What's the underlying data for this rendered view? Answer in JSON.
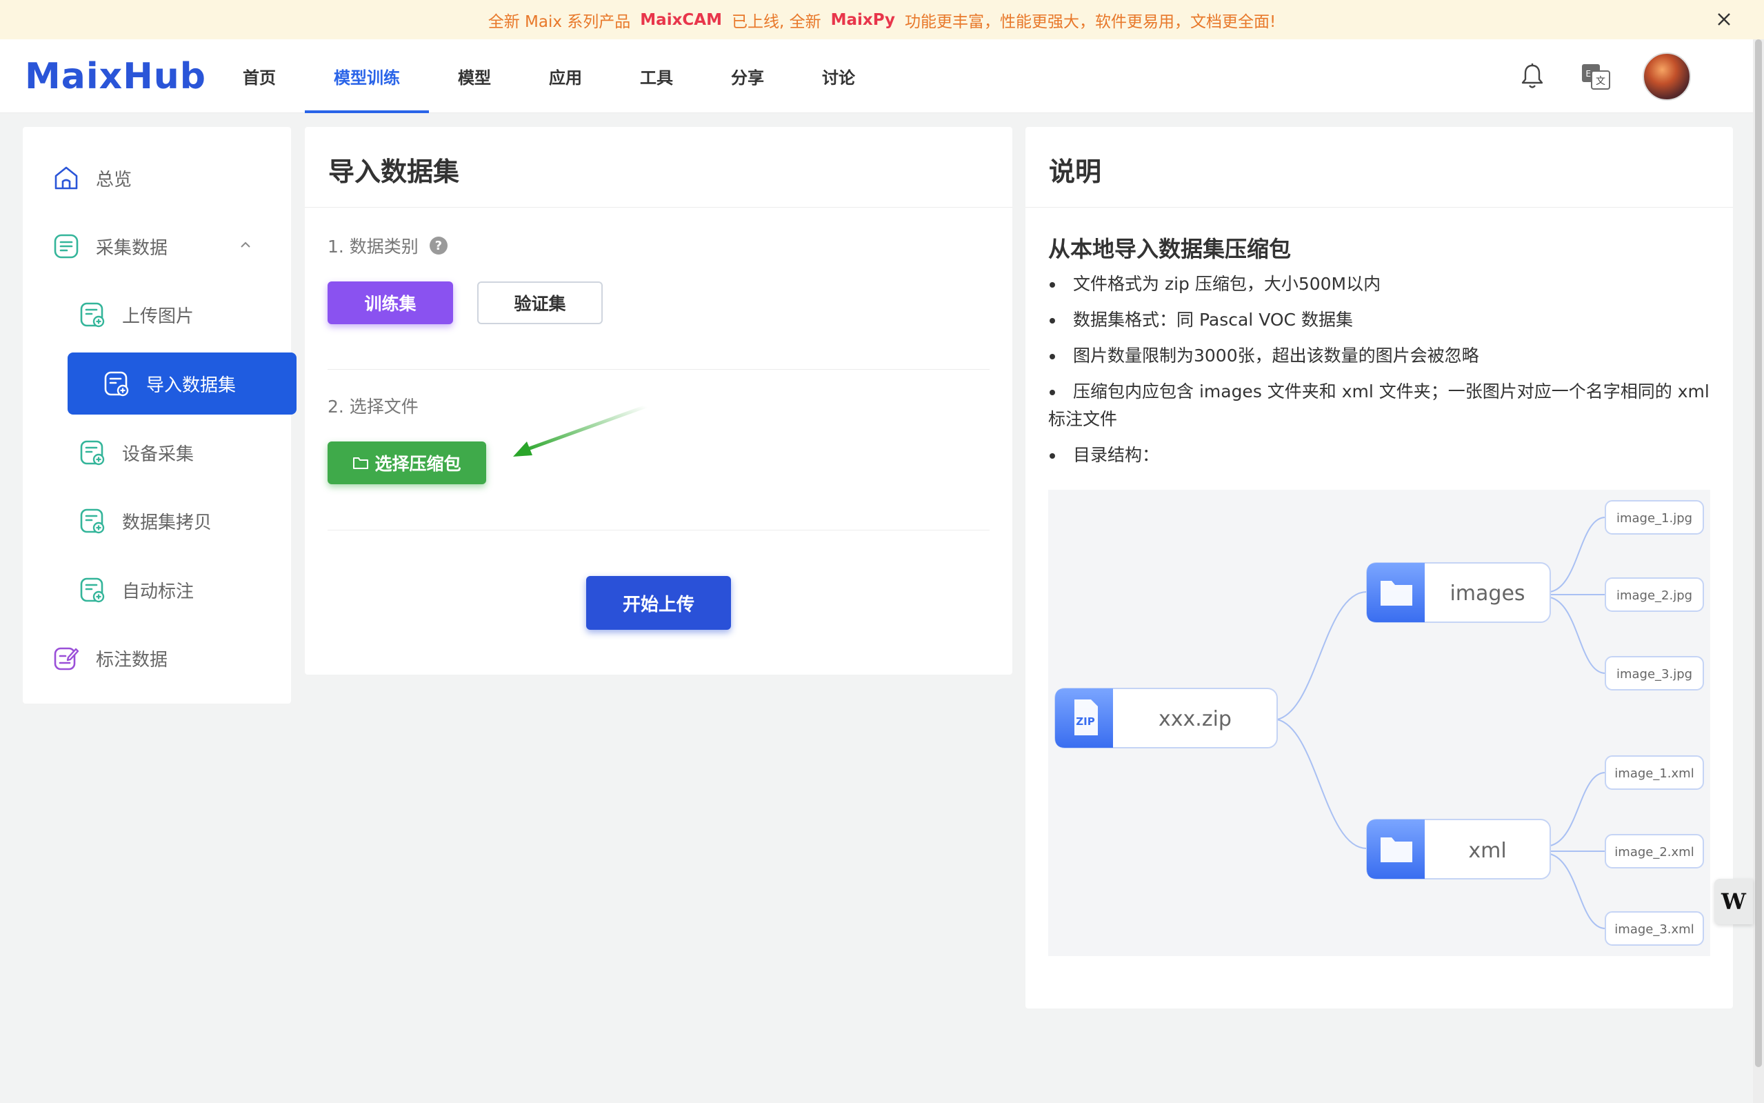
{
  "announcement": {
    "part1": "全新 Maix 系列产品",
    "highlight1": "MaixCAM",
    "part2": "已上线, 全新",
    "highlight2": "MaixPy",
    "part3": "功能更丰富，性能更强大，软件更易用，文档更全面!"
  },
  "header": {
    "logo": "MaixHub",
    "nav": [
      "首页",
      "模型训练",
      "模型",
      "应用",
      "工具",
      "分享",
      "讨论"
    ],
    "active_nav": "模型训练"
  },
  "sidebar": {
    "items": [
      {
        "label": "总览",
        "icon": "home-icon"
      },
      {
        "label": "采集数据",
        "icon": "document-list-icon"
      },
      {
        "label": "上传图片",
        "icon": "document-add-icon"
      },
      {
        "label": "导入数据集",
        "icon": "document-add-icon"
      },
      {
        "label": "设备采集",
        "icon": "document-add-icon"
      },
      {
        "label": "数据集拷贝",
        "icon": "document-add-icon"
      },
      {
        "label": "自动标注",
        "icon": "document-add-icon"
      },
      {
        "label": "标注数据",
        "icon": "edit-icon"
      }
    ],
    "active": "导入数据集"
  },
  "main": {
    "title": "导入数据集",
    "step1": "1. 数据类别",
    "help": "?",
    "train_label": "训练集",
    "val_label": "验证集",
    "step2": "2. 选择文件",
    "pick_label": "选择压缩包",
    "upload_label": "开始上传"
  },
  "info": {
    "title": "说明",
    "subtitle": "从本地导入数据集压缩包",
    "bullets": [
      "文件格式为 zip 压缩包，大小500M以内",
      "数据集格式：同 Pascal VOC 数据集",
      "图片数量限制为3000张，超出该数量的图片会被忽略",
      "压缩包内应包含 images 文件夹和 xml 文件夹；一张图片对应一个名字相同的 xml 标注文件",
      "目录结构："
    ],
    "tree": {
      "root": "xxx.zip",
      "root_icon": "ZIP",
      "folders": [
        {
          "name": "images",
          "files": [
            "image_1.jpg",
            "image_2.jpg",
            "image_3.jpg"
          ]
        },
        {
          "name": "xml",
          "files": [
            "image_1.xml",
            "image_2.xml",
            "image_3.xml"
          ]
        }
      ]
    }
  },
  "widget": {
    "label": "W"
  },
  "colors": {
    "brand": "#2a55d8",
    "active_nav": "#2a64e8",
    "active_side": "#1f5ce0",
    "train_btn": "#8a52f0",
    "pick_btn": "#3faa4a",
    "upload_btn": "#2a51d8",
    "announce_bg": "#fdf6e0",
    "announce_text": "#e8782a",
    "announce_highlight": "#e8364b"
  }
}
